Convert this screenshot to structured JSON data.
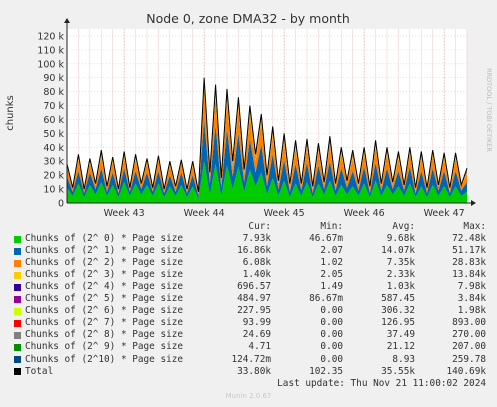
{
  "chart_data": {
    "type": "area",
    "title": "Node 0, zone DMA32 - by month",
    "ylabel": "chunks",
    "ylim": [
      0,
      125000
    ],
    "y_ticks": [
      {
        "value": 0,
        "label": "0"
      },
      {
        "value": 10000,
        "label": "10 k"
      },
      {
        "value": 20000,
        "label": "20 k"
      },
      {
        "value": 30000,
        "label": "30 k"
      },
      {
        "value": 40000,
        "label": "40 k"
      },
      {
        "value": 50000,
        "label": "50 k"
      },
      {
        "value": 60000,
        "label": "60 k"
      },
      {
        "value": 70000,
        "label": "70 k"
      },
      {
        "value": 80000,
        "label": "80 k"
      },
      {
        "value": 90000,
        "label": "90 k"
      },
      {
        "value": 100000,
        "label": "100 k"
      },
      {
        "value": 110000,
        "label": "110 k"
      },
      {
        "value": 120000,
        "label": "120 k"
      }
    ],
    "xlim": [
      0,
      35
    ],
    "x_ticks": [
      {
        "value": 5,
        "label": "Week 43"
      },
      {
        "value": 12,
        "label": "Week 44"
      },
      {
        "value": 19,
        "label": "Week 45"
      },
      {
        "value": 26,
        "label": "Week 46"
      },
      {
        "value": 33,
        "label": "Week 47"
      }
    ],
    "x": [
      0,
      0.5,
      1,
      1.5,
      2,
      2.5,
      3,
      3.5,
      4,
      4.5,
      5,
      5.5,
      6,
      6.5,
      7,
      7.5,
      8,
      8.5,
      9,
      9.5,
      10,
      10.5,
      11,
      11.5,
      12,
      12.5,
      13,
      13.5,
      14,
      14.5,
      15,
      15.5,
      16,
      16.5,
      17,
      17.5,
      18,
      18.5,
      19,
      19.5,
      20,
      20.5,
      21,
      21.5,
      22,
      22.5,
      23,
      23.5,
      24,
      24.5,
      25,
      25.5,
      26,
      26.5,
      27,
      27.5,
      28,
      28.5,
      29,
      29.5,
      30,
      30.5,
      31,
      31.5,
      32,
      32.5,
      33,
      33.5,
      34,
      34.5,
      35
    ],
    "series": [
      {
        "name": "Chunks of (2^ 0) * Page size",
        "color": "#00cc00",
        "values": [
          11000,
          5000,
          14000,
          4000,
          13000,
          6000,
          15000,
          5000,
          13000,
          4000,
          15000,
          5000,
          14000,
          6000,
          13000,
          5000,
          14000,
          4000,
          12000,
          5000,
          13000,
          4000,
          12000,
          3000,
          30000,
          6000,
          28000,
          5000,
          27000,
          10000,
          26000,
          8000,
          24000,
          12000,
          22000,
          6000,
          18000,
          5000,
          16000,
          4000,
          14000,
          5000,
          15000,
          4000,
          14000,
          6000,
          16000,
          5000,
          13000,
          6000,
          12000,
          5000,
          14000,
          4000,
          16000,
          5000,
          13000,
          6000,
          12000,
          5000,
          14000,
          4000,
          12000,
          4000,
          13000,
          5000,
          12000,
          4000,
          12000,
          5000,
          8000
        ]
      },
      {
        "name": "Chunks of (2^ 1) * Page size",
        "color": "#0066b3",
        "values": [
          8000,
          3000,
          9000,
          3000,
          9000,
          4000,
          10000,
          3000,
          9000,
          3000,
          10000,
          3000,
          9000,
          4000,
          9000,
          3000,
          9000,
          3000,
          8000,
          3000,
          9000,
          3000,
          8000,
          2000,
          30000,
          8000,
          28000,
          6000,
          26000,
          9000,
          24000,
          7000,
          22000,
          10000,
          20000,
          6000,
          17000,
          5000,
          15000,
          4000,
          14000,
          4000,
          14000,
          3000,
          13000,
          4000,
          14000,
          4000,
          12000,
          5000,
          11000,
          4000,
          12000,
          3000,
          13000,
          4000,
          12000,
          4000,
          11000,
          4000,
          12000,
          3000,
          11000,
          3000,
          12000,
          4000,
          11000,
          3000,
          11000,
          4000,
          7000
        ]
      },
      {
        "name": "Chunks of (2^ 2) * Page size",
        "color": "#ff8000",
        "values": [
          7000,
          3000,
          8000,
          3000,
          7000,
          3000,
          8000,
          3000,
          8000,
          2000,
          8000,
          3000,
          8000,
          3000,
          7000,
          3000,
          8000,
          2000,
          7000,
          3000,
          7000,
          2000,
          7000,
          2000,
          22000,
          6000,
          20000,
          5000,
          20000,
          7000,
          18000,
          6000,
          17000,
          8000,
          16000,
          5000,
          13000,
          4000,
          12000,
          3000,
          11000,
          3000,
          11000,
          3000,
          10000,
          3000,
          11000,
          3000,
          10000,
          4000,
          9000,
          3000,
          10000,
          3000,
          11000,
          3000,
          10000,
          3000,
          9000,
          3000,
          10000,
          2000,
          9000,
          3000,
          9000,
          3000,
          9000,
          2000,
          9000,
          3000,
          6000
        ]
      },
      {
        "name": "Chunks of (2^ 3) * Page size",
        "color": "#ffcc00",
        "values": [
          1500,
          600,
          1800,
          500,
          1600,
          700,
          1900,
          600,
          1700,
          500,
          1900,
          600,
          1800,
          700,
          1600,
          600,
          1700,
          500,
          1500,
          600,
          1600,
          500,
          1500,
          400,
          4000,
          1200,
          3800,
          1000,
          3600,
          1500,
          3400,
          1200,
          3200,
          1600,
          3000,
          1000,
          2600,
          900,
          2300,
          800,
          2200,
          800,
          2200,
          700,
          2100,
          800,
          2300,
          800,
          2000,
          900,
          1900,
          800,
          2000,
          700,
          2200,
          800,
          2000,
          800,
          1900,
          700,
          2000,
          600,
          1900,
          600,
          1900,
          700,
          1800,
          600,
          1800,
          700,
          1300
        ]
      },
      {
        "name": "Chunks of (2^ 4) * Page size",
        "color": "#330099",
        "values": [
          700,
          300,
          800,
          300,
          700,
          300,
          900,
          300,
          800,
          200,
          900,
          300,
          800,
          300,
          700,
          300,
          800,
          200,
          700,
          300,
          700,
          200,
          700,
          200,
          2000,
          600,
          1800,
          500,
          1700,
          700,
          1600,
          500,
          1500,
          700,
          1400,
          500,
          1200,
          400,
          1100,
          400,
          1000,
          400,
          1000,
          300,
          1000,
          400,
          1100,
          400,
          900,
          400,
          900,
          400,
          900,
          300,
          1000,
          400,
          900,
          400,
          900,
          300,
          900,
          300,
          900,
          300,
          900,
          300,
          800,
          300,
          800,
          300,
          600
        ]
      },
      {
        "name": "Chunks of (2^ 5) * Page size",
        "color": "#990099",
        "values": [
          500,
          200,
          600,
          200,
          500,
          200,
          600,
          200,
          600,
          200,
          600,
          200,
          600,
          200,
          500,
          200,
          600,
          200,
          500,
          200,
          500,
          200,
          500,
          100,
          1200,
          400,
          1100,
          300,
          1100,
          400,
          1000,
          300,
          900,
          500,
          900,
          300,
          800,
          300,
          700,
          300,
          700,
          300,
          700,
          200,
          700,
          300,
          700,
          300,
          600,
          300,
          600,
          300,
          600,
          200,
          700,
          300,
          600,
          300,
          600,
          200,
          600,
          200,
          600,
          200,
          600,
          200,
          600,
          200,
          600,
          200,
          400
        ]
      },
      {
        "name": "Chunks of (2^ 6) * Page size",
        "color": "#ccff00",
        "values": [
          250,
          100,
          300,
          100,
          250,
          100,
          300,
          100,
          300,
          100,
          300,
          100,
          300,
          100,
          250,
          100,
          300,
          100,
          250,
          100,
          250,
          100,
          250,
          50,
          600,
          200,
          550,
          150,
          550,
          200,
          500,
          150,
          450,
          250,
          450,
          150,
          400,
          150,
          350,
          150,
          350,
          150,
          350,
          100,
          350,
          150,
          350,
          150,
          300,
          150,
          300,
          150,
          300,
          100,
          350,
          150,
          300,
          150,
          300,
          100,
          300,
          100,
          300,
          100,
          300,
          100,
          300,
          100,
          300,
          100,
          200
        ]
      },
      {
        "name": "Chunks of (2^ 7) * Page size",
        "color": "#ff0000",
        "values": [
          100,
          40,
          120,
          40,
          100,
          40,
          120,
          40,
          120,
          40,
          120,
          40,
          120,
          40,
          100,
          40,
          120,
          40,
          100,
          40,
          100,
          40,
          100,
          20,
          250,
          80,
          230,
          60,
          230,
          80,
          210,
          60,
          190,
          100,
          190,
          60,
          170,
          60,
          150,
          60,
          150,
          60,
          150,
          40,
          150,
          60,
          150,
          60,
          130,
          60,
          130,
          60,
          130,
          40,
          150,
          60,
          130,
          60,
          130,
          40,
          130,
          40,
          130,
          40,
          130,
          40,
          130,
          40,
          130,
          40,
          90
        ]
      },
      {
        "name": "Chunks of (2^ 8) * Page size",
        "color": "#808080",
        "values": [
          25,
          10,
          30,
          10,
          25,
          10,
          30,
          10,
          30,
          10,
          30,
          10,
          30,
          10,
          25,
          10,
          30,
          10,
          25,
          10,
          25,
          10,
          25,
          5,
          60,
          20,
          55,
          15,
          55,
          20,
          50,
          15,
          45,
          25,
          45,
          15,
          40,
          15,
          35,
          15,
          35,
          15,
          35,
          10,
          35,
          15,
          35,
          15,
          30,
          15,
          30,
          15,
          30,
          10,
          35,
          15,
          30,
          15,
          30,
          10,
          30,
          10,
          30,
          10,
          30,
          10,
          30,
          10,
          30,
          10,
          20
        ]
      },
      {
        "name": "Chunks of (2^ 9) * Page size",
        "color": "#008f00",
        "values": [
          5,
          2,
          6,
          2,
          5,
          2,
          6,
          2,
          6,
          2,
          6,
          2,
          6,
          2,
          5,
          2,
          6,
          2,
          5,
          2,
          5,
          2,
          5,
          1,
          12,
          4,
          11,
          3,
          11,
          4,
          10,
          3,
          9,
          5,
          9,
          3,
          8,
          3,
          7,
          3,
          7,
          3,
          7,
          2,
          7,
          3,
          7,
          3,
          6,
          3,
          6,
          3,
          6,
          2,
          7,
          3,
          6,
          3,
          6,
          2,
          6,
          2,
          6,
          2,
          6,
          2,
          6,
          2,
          6,
          2,
          4
        ]
      },
      {
        "name": "Chunks of (2^10) * Page size",
        "color": "#00487d",
        "values": [
          0,
          0,
          0,
          0,
          0,
          0,
          0,
          0,
          0,
          0,
          0,
          0,
          0,
          0,
          0,
          0,
          0,
          0,
          0,
          0,
          0,
          0,
          0,
          0,
          0,
          0,
          0,
          0,
          0,
          0,
          0,
          0,
          0,
          0,
          0,
          0,
          0,
          0,
          0,
          0,
          0,
          0,
          0,
          0,
          0,
          0,
          0,
          0,
          0,
          0,
          0,
          0,
          0,
          0,
          0,
          0,
          0,
          0,
          0,
          0,
          0,
          0,
          0,
          0,
          0,
          0,
          0,
          0,
          0,
          0,
          0
        ]
      },
      {
        "name": "Total",
        "color": "#000000",
        "values": [
          28000,
          11000,
          35000,
          10000,
          32000,
          14000,
          38000,
          12000,
          33000,
          10000,
          37000,
          11000,
          35000,
          14000,
          32000,
          11000,
          34000,
          10000,
          30000,
          12000,
          31000,
          10000,
          30000,
          8000,
          90000,
          22000,
          85000,
          18000,
          82000,
          30000,
          76000,
          24000,
          70000,
          35000,
          64000,
          20000,
          55000,
          16000,
          50000,
          14000,
          45000,
          14000,
          46000,
          12000,
          43000,
          15000,
          48000,
          14000,
          40000,
          16000,
          38000,
          14000,
          40000,
          12000,
          45000,
          14000,
          40000,
          15000,
          37000,
          13000,
          40000,
          11000,
          37000,
          11000,
          38000,
          13000,
          36000,
          11000,
          36000,
          13000,
          25000
        ]
      }
    ]
  },
  "legend": {
    "headers": {
      "cur": "Cur:",
      "min": "Min:",
      "avg": "Avg:",
      "max": "Max:"
    },
    "rows": [
      {
        "label": "Chunks of (2^ 0) * Page size",
        "color": "#00cc00",
        "cur": "7.93k",
        "min": "46.67m",
        "avg": "9.68k",
        "max": "72.48k"
      },
      {
        "label": "Chunks of (2^ 1) * Page size",
        "color": "#0066b3",
        "cur": "16.86k",
        "min": "2.07",
        "avg": "14.07k",
        "max": "51.17k"
      },
      {
        "label": "Chunks of (2^ 2) * Page size",
        "color": "#ff8000",
        "cur": "6.08k",
        "min": "1.02",
        "avg": "7.35k",
        "max": "28.83k"
      },
      {
        "label": "Chunks of (2^ 3) * Page size",
        "color": "#ffcc00",
        "cur": "1.40k",
        "min": "2.05",
        "avg": "2.33k",
        "max": "13.84k"
      },
      {
        "label": "Chunks of (2^ 4) * Page size",
        "color": "#330099",
        "cur": "696.57",
        "min": "1.49",
        "avg": "1.03k",
        "max": "7.98k"
      },
      {
        "label": "Chunks of (2^ 5) * Page size",
        "color": "#990099",
        "cur": "484.97",
        "min": "86.67m",
        "avg": "587.45",
        "max": "3.84k"
      },
      {
        "label": "Chunks of (2^ 6) * Page size",
        "color": "#ccff00",
        "cur": "227.95",
        "min": "0.00",
        "avg": "306.32",
        "max": "1.98k"
      },
      {
        "label": "Chunks of (2^ 7) * Page size",
        "color": "#ff0000",
        "cur": "93.99",
        "min": "0.00",
        "avg": "126.95",
        "max": "893.00"
      },
      {
        "label": "Chunks of (2^ 8) * Page size",
        "color": "#808080",
        "cur": "24.69",
        "min": "0.00",
        "avg": "37.49",
        "max": "270.00"
      },
      {
        "label": "Chunks of (2^ 9) * Page size",
        "color": "#008f00",
        "cur": "4.71",
        "min": "0.00",
        "avg": "21.12",
        "max": "207.00"
      },
      {
        "label": "Chunks of (2^10) * Page size",
        "color": "#00487d",
        "cur": "124.72m",
        "min": "0.00",
        "avg": "8.93",
        "max": "259.78"
      },
      {
        "label": "Total",
        "color": "#000000",
        "cur": "33.80k",
        "min": "102.35",
        "avg": "35.55k",
        "max": "140.69k"
      }
    ]
  },
  "last_update": "Last update: Thu Nov 21 11:00:02 2024",
  "watermark": "RRDTOOL / TOBI OETIKER",
  "footer": "Munin 2.0.67"
}
